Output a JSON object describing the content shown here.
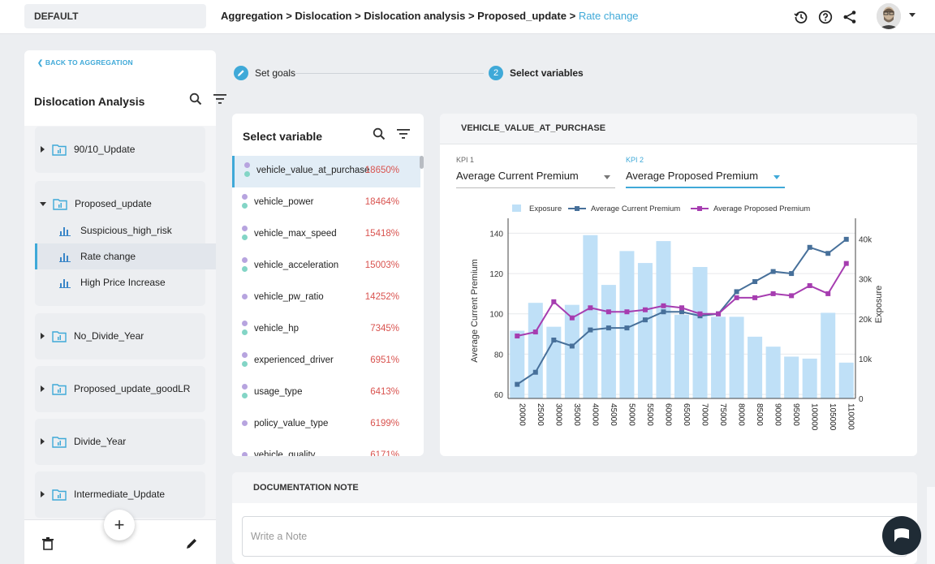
{
  "topbar": {
    "environment": "DEFAULT",
    "breadcrumb": [
      "Aggregation",
      "Dislocation",
      "Dislocation analysis",
      "Proposed_update"
    ],
    "breadcrumb_current": "Rate change",
    "separator": ">",
    "icons": [
      "history-icon",
      "help-icon",
      "share-icon",
      "avatar",
      "chevron-down-icon"
    ]
  },
  "sidebar": {
    "back_label": "BACK TO AGGREGATION",
    "title": "Dislocation Analysis",
    "groups": [
      {
        "label": "90/10_Update",
        "expanded": false
      },
      {
        "label": "Proposed_update",
        "expanded": true,
        "children": [
          {
            "label": "Suspicious_high_risk",
            "active": false
          },
          {
            "label": "Rate change",
            "active": true
          },
          {
            "label": "High Price Increase",
            "active": false
          }
        ]
      },
      {
        "label": "No_Divide_Year",
        "expanded": false
      },
      {
        "label": "Proposed_update_goodLR",
        "expanded": false
      },
      {
        "label": "Divide_Year",
        "expanded": false
      },
      {
        "label": "Intermediate_Update",
        "expanded": false
      }
    ],
    "add_label": "+"
  },
  "stepper": {
    "step1_label": "Set goals",
    "step2_number": "2",
    "step2_label": "Select variables"
  },
  "variables": {
    "title": "Select variable",
    "items": [
      {
        "name": "vehicle_value_at_purchase",
        "pct": "18650%",
        "dots": [
          "purple",
          "teal"
        ],
        "active": true
      },
      {
        "name": "vehicle_power",
        "pct": "18464%",
        "dots": [
          "purple",
          "teal"
        ]
      },
      {
        "name": "vehicle_max_speed",
        "pct": "15418%",
        "dots": [
          "purple",
          "teal"
        ]
      },
      {
        "name": "vehicle_acceleration",
        "pct": "15003%",
        "dots": [
          "purple",
          "teal"
        ]
      },
      {
        "name": "vehicle_pw_ratio",
        "pct": "14252%",
        "dots": [
          "purple"
        ]
      },
      {
        "name": "vehicle_hp",
        "pct": "7345%",
        "dots": [
          "purple",
          "teal"
        ]
      },
      {
        "name": "experienced_driver",
        "pct": "6951%",
        "dots": [
          "purple",
          "teal"
        ]
      },
      {
        "name": "usage_type",
        "pct": "6413%",
        "dots": [
          "purple",
          "teal"
        ]
      },
      {
        "name": "policy_value_type",
        "pct": "6199%",
        "dots": [
          "purple"
        ]
      },
      {
        "name": "vehicle_quality",
        "pct": "6171%",
        "dots": [
          "purple"
        ]
      }
    ]
  },
  "chart_panel": {
    "title": "VEHICLE_VALUE_AT_PURCHASE",
    "kpi1_label": "KPI 1",
    "kpi1_value": "Average Current Premium",
    "kpi2_label": "KPI 2",
    "kpi2_value": "Average Proposed Premium"
  },
  "colors": {
    "accent": "#3fa9d8",
    "bar": "#bfe0f7",
    "line1": "#47709a",
    "line2": "#a63db0",
    "pct": "#d9534f"
  },
  "chart_data": {
    "type": "bar",
    "categories": [
      "20000",
      "25000",
      "30000",
      "35000",
      "40000",
      "45000",
      "50000",
      "55000",
      "60000",
      "65000",
      "70000",
      "75000",
      "80000",
      "85000",
      "90000",
      "95000",
      "100000",
      "105000",
      "110000"
    ],
    "legend": [
      "Exposure",
      "Average Current Premium",
      "Average Proposed Premium"
    ],
    "series": [
      {
        "name": "Exposure",
        "type": "bar",
        "axis": "right",
        "values": [
          17000,
          24000,
          18000,
          23500,
          41000,
          28500,
          37000,
          34000,
          39500,
          21000,
          33000,
          20500,
          20500,
          15500,
          13000,
          10500,
          10000,
          21500,
          9000
        ]
      },
      {
        "name": "Average Current Premium",
        "type": "line",
        "axis": "left",
        "values": [
          65,
          71,
          87,
          84,
          92,
          93,
          93,
          97,
          101,
          101,
          99,
          100,
          111,
          116,
          121,
          120,
          133,
          130,
          137
        ]
      },
      {
        "name": "Average Proposed Premium",
        "type": "line",
        "axis": "left",
        "values": [
          89,
          91,
          106,
          98,
          103,
          101,
          101,
          102,
          104,
          103,
          100,
          100,
          108,
          108,
          110,
          109,
          114,
          110,
          125
        ]
      }
    ],
    "ylabel": "Average Current Premium",
    "y2label": "Exposure",
    "ylim": [
      58,
      145
    ],
    "y2lim": [
      0,
      44000
    ],
    "yticks": [
      60,
      80,
      100,
      120,
      140
    ],
    "y2ticks": [
      "0",
      "10k",
      "20k",
      "30k",
      "40k"
    ],
    "grid": true,
    "legend_position": "top"
  },
  "documentation": {
    "title": "DOCUMENTATION NOTE",
    "placeholder": "Write a Note"
  }
}
